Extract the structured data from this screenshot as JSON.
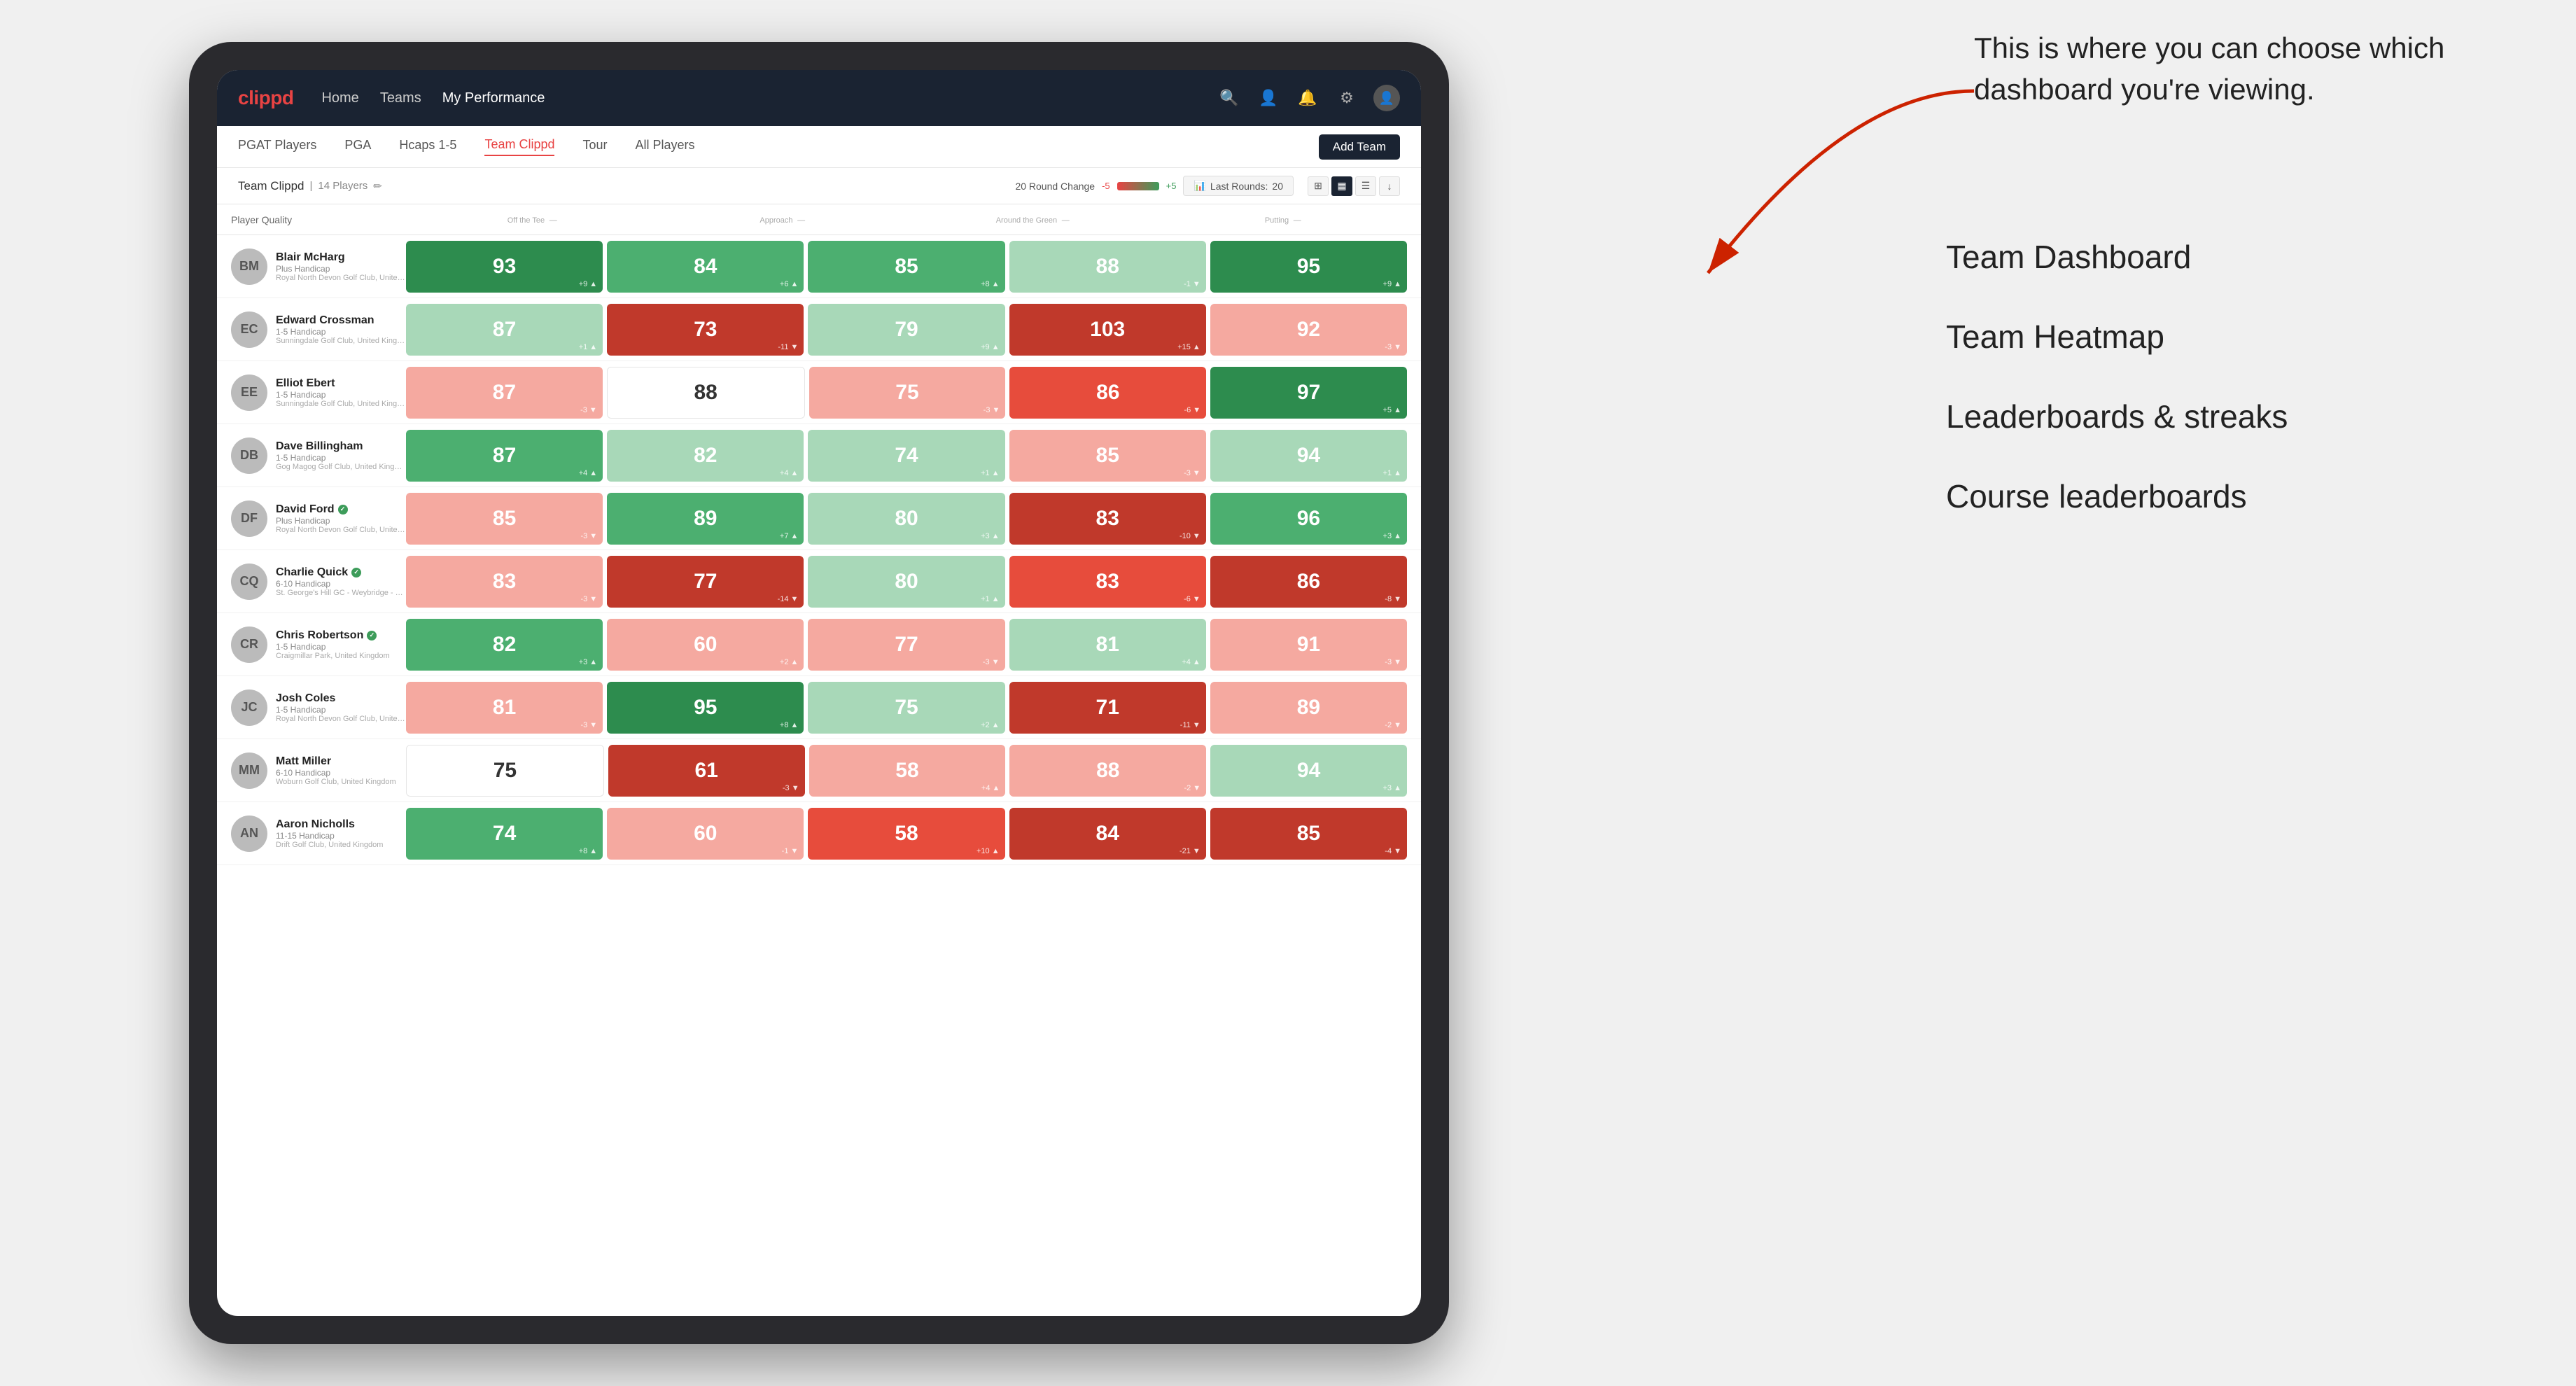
{
  "annotation": {
    "text": "This is where you can choose which dashboard you're viewing.",
    "items": [
      {
        "label": "Team Dashboard"
      },
      {
        "label": "Team Heatmap"
      },
      {
        "label": "Leaderboards & streaks"
      },
      {
        "label": "Course leaderboards"
      }
    ]
  },
  "nav": {
    "logo": "clippd",
    "items": [
      "Home",
      "Teams",
      "My Performance"
    ],
    "active": "My Performance"
  },
  "subnav": {
    "items": [
      "PGAT Players",
      "PGA",
      "Hcaps 1-5",
      "Team Clippd",
      "Tour",
      "All Players"
    ],
    "active": "Team Clippd",
    "addTeamLabel": "Add Team"
  },
  "teamHeader": {
    "name": "Team Clippd",
    "separator": "|",
    "count": "14 Players",
    "roundChangeLabel": "20 Round Change",
    "redValue": "-5",
    "greenValue": "+5",
    "lastRoundsLabel": "Last Rounds:",
    "lastRoundsValue": "20"
  },
  "tableColumns": {
    "player": "Player Quality",
    "offTee": "Off the Tee",
    "approach": "Approach",
    "aroundGreen": "Around the Green",
    "putting": "Putting"
  },
  "players": [
    {
      "name": "Blair McHarg",
      "hdcp": "Plus Handicap",
      "club": "Royal North Devon Golf Club, United Kingdom",
      "verified": false,
      "scores": {
        "quality": {
          "val": 93,
          "change": "+9",
          "dir": "up",
          "color": "c-green-dark"
        },
        "offTee": {
          "val": 84,
          "change": "+6",
          "dir": "up",
          "color": "c-green-mid"
        },
        "approach": {
          "val": 85,
          "change": "+8",
          "dir": "up",
          "color": "c-green-mid"
        },
        "aroundGreen": {
          "val": 88,
          "change": "-1",
          "dir": "down",
          "color": "c-green-light"
        },
        "putting": {
          "val": 95,
          "change": "+9",
          "dir": "up",
          "color": "c-green-dark"
        }
      }
    },
    {
      "name": "Edward Crossman",
      "hdcp": "1-5 Handicap",
      "club": "Sunningdale Golf Club, United Kingdom",
      "verified": false,
      "scores": {
        "quality": {
          "val": 87,
          "change": "+1",
          "dir": "up",
          "color": "c-green-light"
        },
        "offTee": {
          "val": 73,
          "change": "-11",
          "dir": "down",
          "color": "c-red-dark"
        },
        "approach": {
          "val": 79,
          "change": "+9",
          "dir": "up",
          "color": "c-green-light"
        },
        "aroundGreen": {
          "val": 103,
          "change": "+15",
          "dir": "up",
          "color": "c-red-dark"
        },
        "putting": {
          "val": 92,
          "change": "-3",
          "dir": "down",
          "color": "c-red-light"
        }
      }
    },
    {
      "name": "Elliot Ebert",
      "hdcp": "1-5 Handicap",
      "club": "Sunningdale Golf Club, United Kingdom",
      "verified": false,
      "scores": {
        "quality": {
          "val": 87,
          "change": "-3",
          "dir": "down",
          "color": "c-red-light"
        },
        "offTee": {
          "val": 88,
          "change": "",
          "dir": "",
          "color": "c-white"
        },
        "approach": {
          "val": 75,
          "change": "-3",
          "dir": "down",
          "color": "c-red-light"
        },
        "aroundGreen": {
          "val": 86,
          "change": "-6",
          "dir": "down",
          "color": "c-red-mid"
        },
        "putting": {
          "val": 97,
          "change": "+5",
          "dir": "up",
          "color": "c-green-dark"
        }
      }
    },
    {
      "name": "Dave Billingham",
      "hdcp": "1-5 Handicap",
      "club": "Gog Magog Golf Club, United Kingdom",
      "verified": false,
      "scores": {
        "quality": {
          "val": 87,
          "change": "+4",
          "dir": "up",
          "color": "c-green-mid"
        },
        "offTee": {
          "val": 82,
          "change": "+4",
          "dir": "up",
          "color": "c-green-light"
        },
        "approach": {
          "val": 74,
          "change": "+1",
          "dir": "up",
          "color": "c-green-light"
        },
        "aroundGreen": {
          "val": 85,
          "change": "-3",
          "dir": "down",
          "color": "c-red-light"
        },
        "putting": {
          "val": 94,
          "change": "+1",
          "dir": "up",
          "color": "c-green-light"
        }
      }
    },
    {
      "name": "David Ford",
      "hdcp": "Plus Handicap",
      "club": "Royal North Devon Golf Club, United Kingdom",
      "verified": true,
      "scores": {
        "quality": {
          "val": 85,
          "change": "-3",
          "dir": "down",
          "color": "c-red-light"
        },
        "offTee": {
          "val": 89,
          "change": "+7",
          "dir": "up",
          "color": "c-green-mid"
        },
        "approach": {
          "val": 80,
          "change": "+3",
          "dir": "up",
          "color": "c-green-light"
        },
        "aroundGreen": {
          "val": 83,
          "change": "-10",
          "dir": "down",
          "color": "c-red-dark"
        },
        "putting": {
          "val": 96,
          "change": "+3",
          "dir": "up",
          "color": "c-green-mid"
        }
      }
    },
    {
      "name": "Charlie Quick",
      "hdcp": "6-10 Handicap",
      "club": "St. George's Hill GC - Weybridge - Surrey, Uni...",
      "verified": true,
      "scores": {
        "quality": {
          "val": 83,
          "change": "-3",
          "dir": "down",
          "color": "c-red-light"
        },
        "offTee": {
          "val": 77,
          "change": "-14",
          "dir": "down",
          "color": "c-red-dark"
        },
        "approach": {
          "val": 80,
          "change": "+1",
          "dir": "up",
          "color": "c-green-light"
        },
        "aroundGreen": {
          "val": 83,
          "change": "-6",
          "dir": "down",
          "color": "c-red-mid"
        },
        "putting": {
          "val": 86,
          "change": "-8",
          "dir": "down",
          "color": "c-red-dark"
        }
      }
    },
    {
      "name": "Chris Robertson",
      "hdcp": "1-5 Handicap",
      "club": "Craigmillar Park, United Kingdom",
      "verified": true,
      "scores": {
        "quality": {
          "val": 82,
          "change": "+3",
          "dir": "up",
          "color": "c-green-mid"
        },
        "offTee": {
          "val": 60,
          "change": "+2",
          "dir": "up",
          "color": "c-red-light"
        },
        "approach": {
          "val": 77,
          "change": "-3",
          "dir": "down",
          "color": "c-red-light"
        },
        "aroundGreen": {
          "val": 81,
          "change": "+4",
          "dir": "up",
          "color": "c-green-light"
        },
        "putting": {
          "val": 91,
          "change": "-3",
          "dir": "down",
          "color": "c-red-light"
        }
      }
    },
    {
      "name": "Josh Coles",
      "hdcp": "1-5 Handicap",
      "club": "Royal North Devon Golf Club, United Kingdom",
      "verified": false,
      "scores": {
        "quality": {
          "val": 81,
          "change": "-3",
          "dir": "down",
          "color": "c-red-light"
        },
        "offTee": {
          "val": 95,
          "change": "+8",
          "dir": "up",
          "color": "c-green-dark"
        },
        "approach": {
          "val": 75,
          "change": "+2",
          "dir": "up",
          "color": "c-green-light"
        },
        "aroundGreen": {
          "val": 71,
          "change": "-11",
          "dir": "down",
          "color": "c-red-dark"
        },
        "putting": {
          "val": 89,
          "change": "-2",
          "dir": "down",
          "color": "c-red-light"
        }
      }
    },
    {
      "name": "Matt Miller",
      "hdcp": "6-10 Handicap",
      "club": "Woburn Golf Club, United Kingdom",
      "verified": false,
      "scores": {
        "quality": {
          "val": 75,
          "change": "",
          "dir": "",
          "color": "c-white"
        },
        "offTee": {
          "val": 61,
          "change": "-3",
          "dir": "down",
          "color": "c-red-dark"
        },
        "approach": {
          "val": 58,
          "change": "+4",
          "dir": "up",
          "color": "c-red-light"
        },
        "aroundGreen": {
          "val": 88,
          "change": "-2",
          "dir": "down",
          "color": "c-red-light"
        },
        "putting": {
          "val": 94,
          "change": "+3",
          "dir": "up",
          "color": "c-green-light"
        }
      }
    },
    {
      "name": "Aaron Nicholls",
      "hdcp": "11-15 Handicap",
      "club": "Drift Golf Club, United Kingdom",
      "verified": false,
      "scores": {
        "quality": {
          "val": 74,
          "change": "+8",
          "dir": "up",
          "color": "c-green-mid"
        },
        "offTee": {
          "val": 60,
          "change": "-1",
          "dir": "down",
          "color": "c-red-light"
        },
        "approach": {
          "val": 58,
          "change": "+10",
          "dir": "up",
          "color": "c-red-mid"
        },
        "aroundGreen": {
          "val": 84,
          "change": "-21",
          "dir": "down",
          "color": "c-red-dark"
        },
        "putting": {
          "val": 85,
          "change": "-4",
          "dir": "down",
          "color": "c-red-dark"
        }
      }
    }
  ]
}
